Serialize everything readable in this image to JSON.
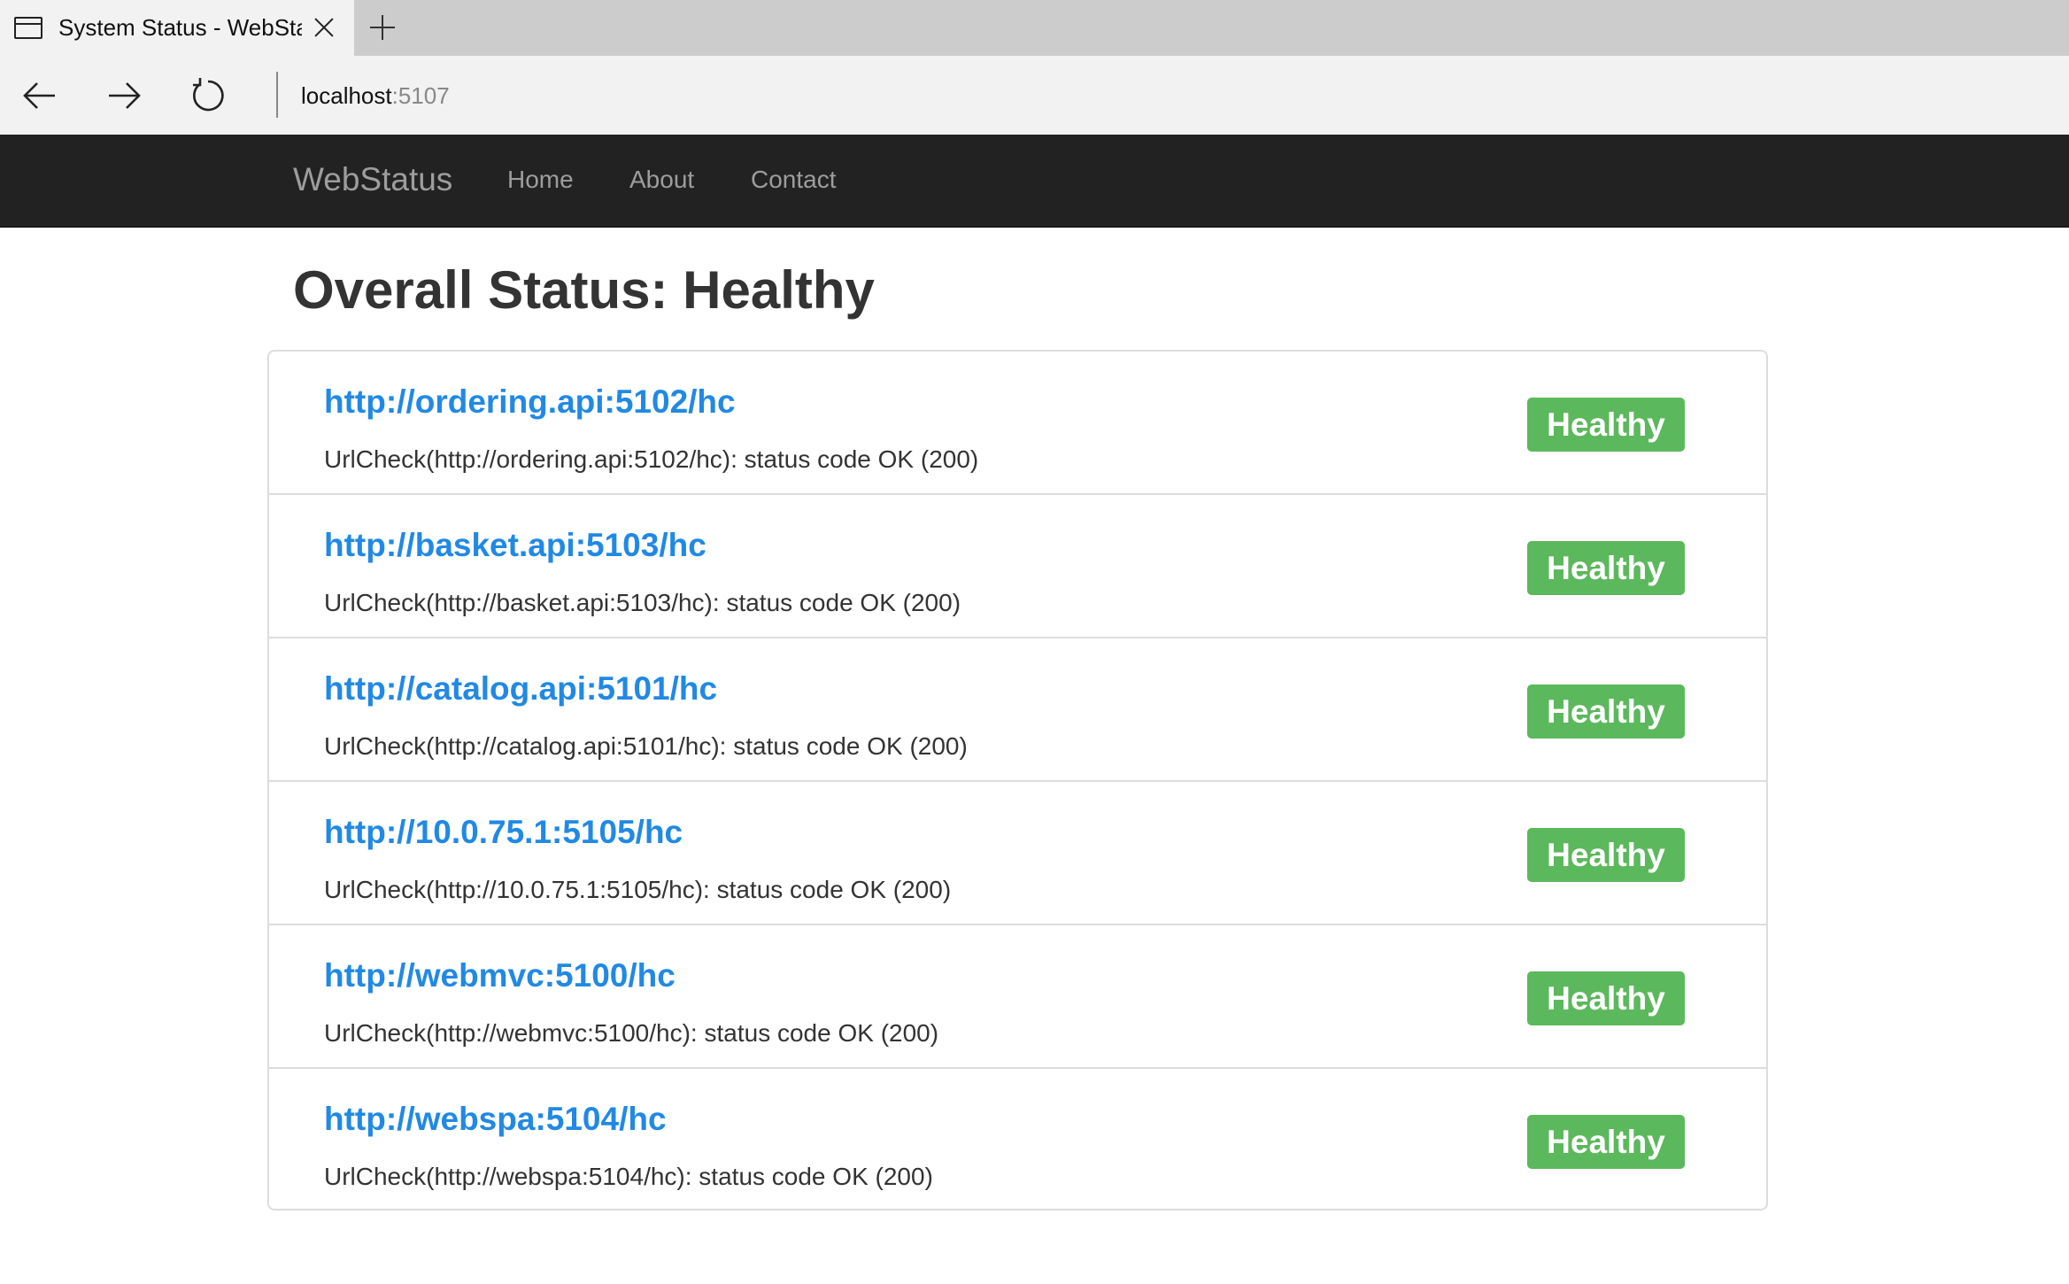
{
  "browser": {
    "tab_title": "System Status - WebSta",
    "url_host": "localhost",
    "url_port": ":5107"
  },
  "navbar": {
    "brand": "WebStatus",
    "links": [
      {
        "label": "Home"
      },
      {
        "label": "About"
      },
      {
        "label": "Contact"
      }
    ]
  },
  "page": {
    "title": "Overall Status: Healthy"
  },
  "checks": [
    {
      "url": "http://ordering.api:5102/hc",
      "description": "UrlCheck(http://ordering.api:5102/hc): status code OK (200)",
      "status": "Healthy"
    },
    {
      "url": "http://basket.api:5103/hc",
      "description": "UrlCheck(http://basket.api:5103/hc): status code OK (200)",
      "status": "Healthy"
    },
    {
      "url": "http://catalog.api:5101/hc",
      "description": "UrlCheck(http://catalog.api:5101/hc): status code OK (200)",
      "status": "Healthy"
    },
    {
      "url": "http://10.0.75.1:5105/hc",
      "description": "UrlCheck(http://10.0.75.1:5105/hc): status code OK (200)",
      "status": "Healthy"
    },
    {
      "url": "http://webmvc:5100/hc",
      "description": "UrlCheck(http://webmvc:5100/hc): status code OK (200)",
      "status": "Healthy"
    },
    {
      "url": "http://webspa:5104/hc",
      "description": "UrlCheck(http://webspa:5104/hc): status code OK (200)",
      "status": "Healthy"
    }
  ],
  "colors": {
    "link": "#2189e4",
    "healthy_badge": "#5cb85c",
    "navbar_bg": "#222222"
  },
  "icons": {
    "tab": "page-icon",
    "close": "close-icon",
    "new_tab": "plus-icon",
    "back": "arrow-left-icon",
    "forward": "arrow-right-icon",
    "reload": "refresh-icon"
  }
}
